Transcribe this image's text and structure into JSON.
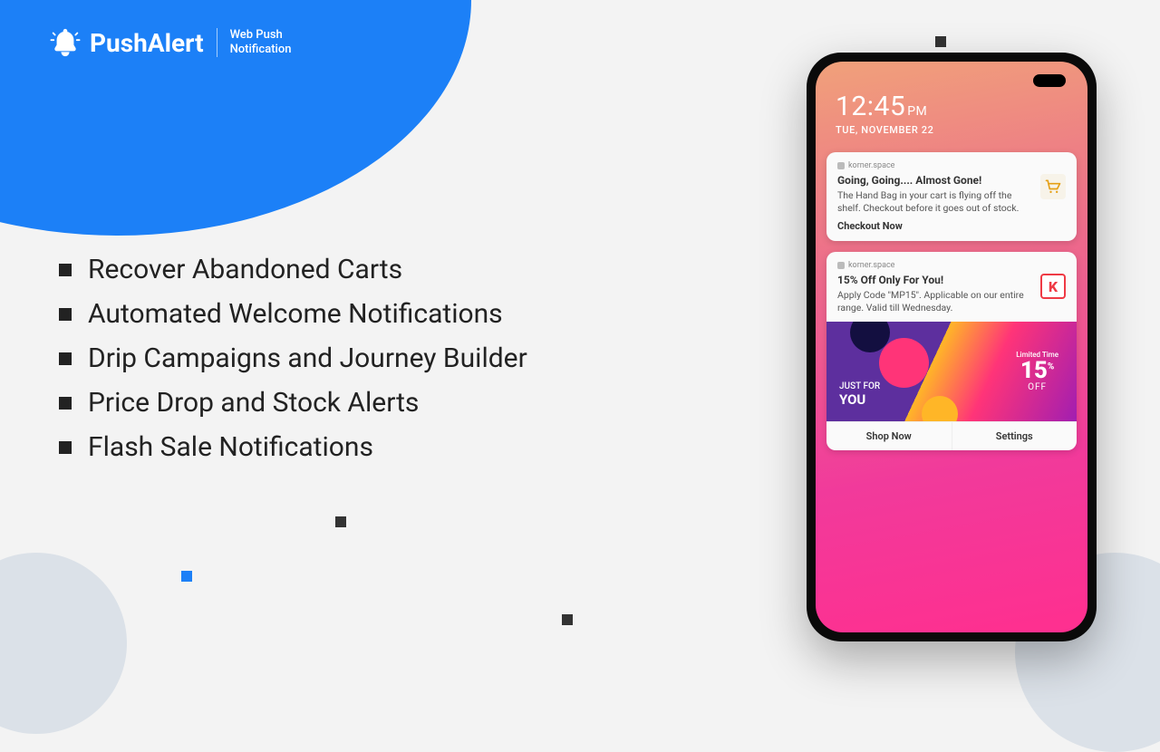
{
  "brand": {
    "name": "PushAlert",
    "tagline_line1": "Web Push",
    "tagline_line2": "Notification"
  },
  "features": [
    "Recover Abandoned Carts",
    "Automated Welcome Notifications",
    "Drip Campaigns and Journey Builder",
    "Price Drop and Stock Alerts",
    "Flash Sale Notifications"
  ],
  "phone": {
    "time": "12:45",
    "ampm": "PM",
    "date": "TUE, NOVEMBER 22",
    "notif1": {
      "source": "korner.space",
      "title": "Going, Going.... Almost Gone!",
      "body": "The Hand Bag in your cart is flying off the shelf. Checkout before it goes out of stock.",
      "cta": "Checkout Now"
    },
    "notif2": {
      "source": "korner.space",
      "title": "15% Off Only For You!",
      "body": "Apply Code \"MP15\". Applicable on our entire range. Valid till Wednesday.",
      "icon_letter": "K",
      "promo": {
        "smalltext": "JUST FOR",
        "big": "YOU",
        "limited": "Limited Time",
        "percent": "15",
        "percent_sym": "%",
        "off": "OFF"
      },
      "action1": "Shop Now",
      "action2": "Settings"
    }
  }
}
